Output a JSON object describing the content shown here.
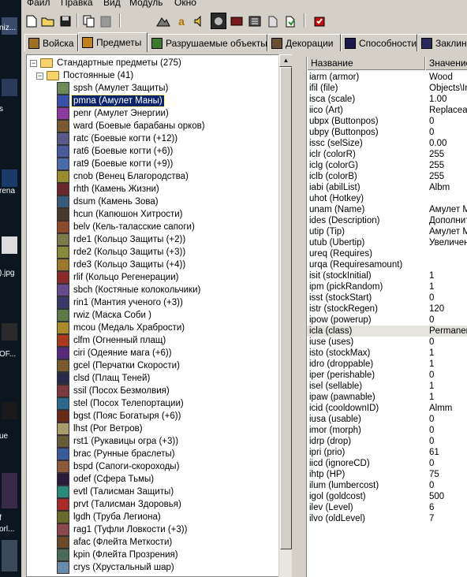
{
  "desktop": {
    "labels": [
      "niz...",
      "s",
      "rena",
      ").jpg",
      "OF...",
      "ue",
      "f",
      "orl..."
    ]
  },
  "menu": [
    "Файл",
    "Правка",
    "Вид",
    "Модуль",
    "Окно"
  ],
  "toolbar": {
    "icons": [
      "new-file-icon",
      "open-folder-icon",
      "save-icon",
      "copy-icon",
      "paste-icon",
      "terrain-icon",
      "gold-icon",
      "sound-icon",
      "unit-icon",
      "ability-icon",
      "grid-icon",
      "import-icon",
      "export-icon",
      "test-map-icon"
    ]
  },
  "tabs": [
    {
      "label": "Войска",
      "icon": "unit-tab-icon"
    },
    {
      "label": "Предметы",
      "icon": "item-tab-icon",
      "active": true
    },
    {
      "label": "Разрушаемые объекты",
      "icon": "destructible-tab-icon"
    },
    {
      "label": "Декорации",
      "icon": "doodad-tab-icon"
    },
    {
      "label": "Способности",
      "icon": "ability-tab-icon"
    },
    {
      "label": "Заклин",
      "icon": "spell-tab-icon"
    }
  ],
  "tree": {
    "root": "Стандартные предметы (275)",
    "group": "Постоянные (41)",
    "items": [
      {
        "label": "spsh (Амулет Защиты)",
        "color": "#6b8a5c"
      },
      {
        "label": "pmna (Амулет Маны)",
        "color": "#3a4fa8",
        "selected": true
      },
      {
        "label": "penr (Амулет Энергии)",
        "color": "#8a3aa0"
      },
      {
        "label": "ward (Боевые барабаны орков)",
        "color": "#7a5a30"
      },
      {
        "label": "ratc (Боевые когти (+12))",
        "color": "#5a5a8a"
      },
      {
        "label": "rat6 (Боевые когти (+6))",
        "color": "#4a5a9a"
      },
      {
        "label": "rat9 (Боевые когти (+9))",
        "color": "#4a6aaa"
      },
      {
        "label": "cnob (Венец Благородства)",
        "color": "#9a8a30"
      },
      {
        "label": "rhth (Камень Жизни)",
        "color": "#6a2a2a"
      },
      {
        "label": "dsum (Камень Зова)",
        "color": "#3a5a7a"
      },
      {
        "label": "hcun (Капюшон Хитрости)",
        "color": "#4a3a2a"
      },
      {
        "label": "belv (Кель-таласские сапоги)",
        "color": "#8a4a2a"
      },
      {
        "label": "rde1 (Кольцо Защиты (+2))",
        "color": "#7a7a4a"
      },
      {
        "label": "rde2 (Кольцо Защиты (+3))",
        "color": "#8a8a3a"
      },
      {
        "label": "rde3 (Кольцо Защиты (+4))",
        "color": "#9a7a2a"
      },
      {
        "label": "rlif (Кольцо Регенерации)",
        "color": "#8a2a2a"
      },
      {
        "label": "sbch (Костяные колокольчики)",
        "color": "#6a4a8a"
      },
      {
        "label": "rin1 (Мантия ученого (+3))",
        "color": "#3a3a6a"
      },
      {
        "label": "rwiz (Маска Соби )",
        "color": "#5a7a4a"
      },
      {
        "label": "mcou (Медаль Храбрости)",
        "color": "#aa8a2a"
      },
      {
        "label": "clfm (Огненный плащ)",
        "color": "#aa3a1a"
      },
      {
        "label": "ciri (Одеяние мага (+6))",
        "color": "#5a2a7a"
      },
      {
        "label": "gcel (Перчатки Скорости)",
        "color": "#7a5a2a"
      },
      {
        "label": "clsd (Плащ Теней)",
        "color": "#2a2a4a"
      },
      {
        "label": "ssil (Посох Безмолвия)",
        "color": "#7a3a3a"
      },
      {
        "label": "stel (Посох Телепортации)",
        "color": "#2a6a8a"
      },
      {
        "label": "bgst (Пояс Богатыря (+6))",
        "color": "#6a2a1a"
      },
      {
        "label": "lhst (Рог Ветров)",
        "color": "#aa9a6a"
      },
      {
        "label": "rst1 (Рукавицы огра (+3))",
        "color": "#6a5a3a"
      },
      {
        "label": "brac (Рунные браслеты)",
        "color": "#3a5a9a"
      },
      {
        "label": "bspd (Сапоги-скороходы)",
        "color": "#8a5a3a"
      },
      {
        "label": "odef (Сфера Тьмы)",
        "color": "#2a1a3a"
      },
      {
        "label": "evtl (Талисман Защиты)",
        "color": "#2a8a7a"
      },
      {
        "label": "prvt (Талисман Здоровья)",
        "color": "#aa2a2a"
      },
      {
        "label": "lgdh (Труба Легиона)",
        "color": "#6a6a2a"
      },
      {
        "label": "rag1 (Туфли Ловкости (+3))",
        "color": "#8a4a4a"
      },
      {
        "label": "afac (Флейта Меткости)",
        "color": "#6a4a2a"
      },
      {
        "label": "kpin (Флейта Прозрения)",
        "color": "#4a6a5a"
      },
      {
        "label": "crys (Хрустальный шар)",
        "color": "#6a8aaa"
      }
    ]
  },
  "props": {
    "header_name": "Название",
    "header_value": "Значение",
    "rows": [
      {
        "name": "iarm (armor)",
        "value": "Wood"
      },
      {
        "name": "ifil (file)",
        "value": "Objects\\Inventory"
      },
      {
        "name": "isca (scale)",
        "value": "1.00"
      },
      {
        "name": "iico (Art)",
        "value": "ReplaceableTex"
      },
      {
        "name": "ubpx (Buttonpos)",
        "value": "0"
      },
      {
        "name": "ubpy (Buttonpos)",
        "value": "0"
      },
      {
        "name": "issc (selSize)",
        "value": "0.00"
      },
      {
        "name": "iclr (colorR)",
        "value": "255"
      },
      {
        "name": "iclg (colorG)",
        "value": "255"
      },
      {
        "name": "iclb (colorB)",
        "value": "255"
      },
      {
        "name": "iabi (abilList)",
        "value": "Albm"
      },
      {
        "name": "uhot (Hotkey)",
        "value": ""
      },
      {
        "name": "unam (Name)",
        "value": "Амулет Маны"
      },
      {
        "name": "ides (Description)",
        "value": "Дополнительна"
      },
      {
        "name": "utip (Tip)",
        "value": "Амулет Маны"
      },
      {
        "name": "utub (Ubertip)",
        "value": "Увеличение за"
      },
      {
        "name": "ureq (Requires)",
        "value": ""
      },
      {
        "name": "urqa (Requiresamount)",
        "value": ""
      },
      {
        "name": "isit (stockInitial)",
        "value": "1"
      },
      {
        "name": "ipm (pickRandom)",
        "value": "1"
      },
      {
        "name": "isst (stockStart)",
        "value": "0"
      },
      {
        "name": "istr (stockRegen)",
        "value": "120"
      },
      {
        "name": "ipow (powerup)",
        "value": "0"
      },
      {
        "name": "icla (class)",
        "value": "Permanent",
        "highlight": true
      },
      {
        "name": "iuse (uses)",
        "value": "0"
      },
      {
        "name": "isto (stockMax)",
        "value": "1"
      },
      {
        "name": "idro (droppable)",
        "value": "1"
      },
      {
        "name": "iper (perishable)",
        "value": "0"
      },
      {
        "name": "isel (sellable)",
        "value": "1"
      },
      {
        "name": "ipaw (pawnable)",
        "value": "1"
      },
      {
        "name": "icid (cooldownID)",
        "value": "Almm"
      },
      {
        "name": "iusa (usable)",
        "value": "0"
      },
      {
        "name": "imor (morph)",
        "value": "0"
      },
      {
        "name": "idrp (drop)",
        "value": "0"
      },
      {
        "name": "ipri (prio)",
        "value": "61"
      },
      {
        "name": "iicd (ignoreCD)",
        "value": "0"
      },
      {
        "name": "ihtp (HP)",
        "value": "75"
      },
      {
        "name": "ilum (lumbercost)",
        "value": "0"
      },
      {
        "name": "igol (goldcost)",
        "value": "500"
      },
      {
        "name": "ilev (Level)",
        "value": "6"
      },
      {
        "name": "ilvo (oldLevel)",
        "value": "7"
      }
    ]
  }
}
